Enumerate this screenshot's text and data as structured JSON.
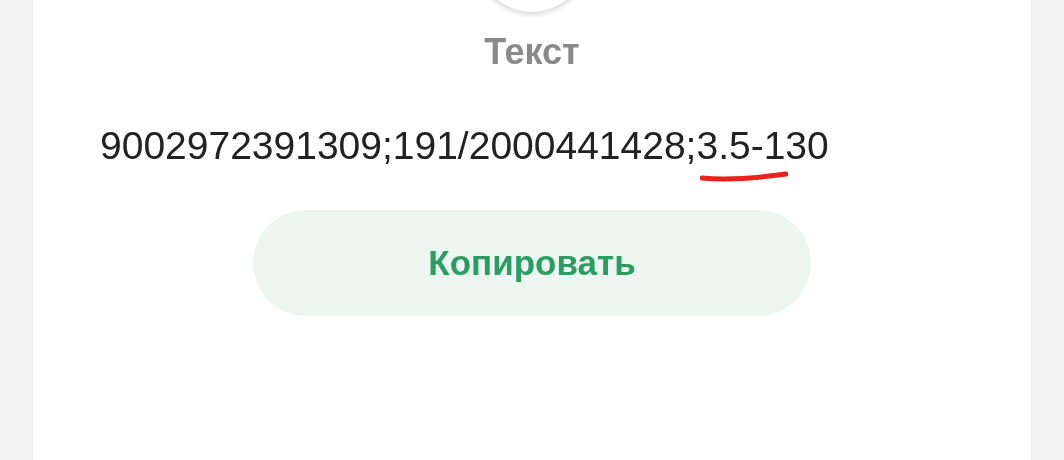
{
  "dialog": {
    "title": "Текст",
    "content": "9002972391309;191/2000441428;3.5-130",
    "button": "Копировать"
  }
}
